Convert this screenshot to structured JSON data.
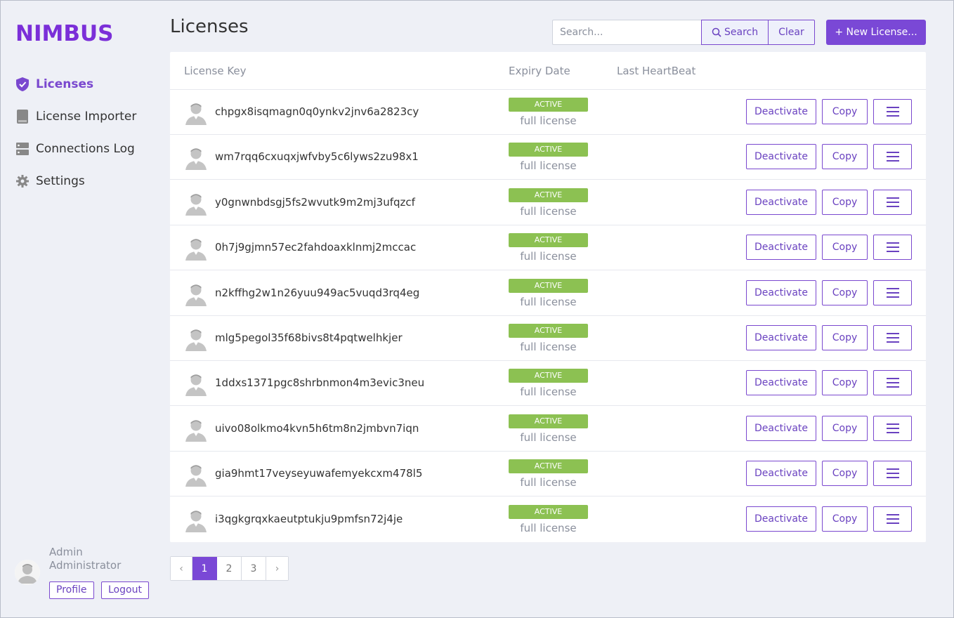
{
  "app": {
    "logo_text": "NIMBUS",
    "brand_color": "#7b2fd8",
    "accent_color": "#7a48d6",
    "success_color": "#8cc152"
  },
  "sidebar": {
    "items": [
      {
        "label": "Licenses",
        "icon": "shield-check-icon",
        "active": true
      },
      {
        "label": "License Importer",
        "icon": "book-icon",
        "active": false
      },
      {
        "label": "Connections Log",
        "icon": "server-icon",
        "active": false
      },
      {
        "label": "Settings",
        "icon": "gear-icon",
        "active": false
      }
    ],
    "user": {
      "name": "Admin",
      "role": "Administrator",
      "profile_label": "Profile",
      "logout_label": "Logout"
    }
  },
  "header": {
    "title": "Licenses",
    "search_placeholder": "Search...",
    "search_label": "Search",
    "clear_label": "Clear",
    "new_label": "+ New License..."
  },
  "table": {
    "columns": [
      "License Key",
      "Expiry Date",
      "Last HeartBeat"
    ],
    "rows": [
      {
        "key": "chpgx8isqmagn0q0ynkv2jnv6a2823cy",
        "status": "ACTIVE",
        "type": "full license"
      },
      {
        "key": "wm7rqq6cxuqxjwfvby5c6lyws2zu98x1",
        "status": "ACTIVE",
        "type": "full license"
      },
      {
        "key": "y0gnwnbdsgj5fs2wvutk9m2mj3ufqzcf",
        "status": "ACTIVE",
        "type": "full license"
      },
      {
        "key": "0h7j9gjmn57ec2fahdoaxklnmj2mccac",
        "status": "ACTIVE",
        "type": "full license"
      },
      {
        "key": "n2kffhg2w1n26yuu949ac5vuqd3rq4eg",
        "status": "ACTIVE",
        "type": "full license"
      },
      {
        "key": "mlg5pegol35f68bivs8t4pqtwelhkjer",
        "status": "ACTIVE",
        "type": "full license"
      },
      {
        "key": "1ddxs1371pgc8shrbnmon4m3evic3neu",
        "status": "ACTIVE",
        "type": "full license"
      },
      {
        "key": "uivo08olkmo4kvn5h6tm8n2jmbvn7iqn",
        "status": "ACTIVE",
        "type": "full license"
      },
      {
        "key": "gia9hmt17veyseyuwafemyekcxm478l5",
        "status": "ACTIVE",
        "type": "full license"
      },
      {
        "key": "i3qgkgrqxkaeutptukju9pmfsn72j4je",
        "status": "ACTIVE",
        "type": "full license"
      }
    ],
    "actions": {
      "deactivate": "Deactivate",
      "copy": "Copy",
      "menu_icon": "hamburger-menu-icon"
    }
  },
  "pagination": {
    "prev": "‹",
    "next": "›",
    "pages": [
      "1",
      "2",
      "3"
    ],
    "current": "1"
  }
}
